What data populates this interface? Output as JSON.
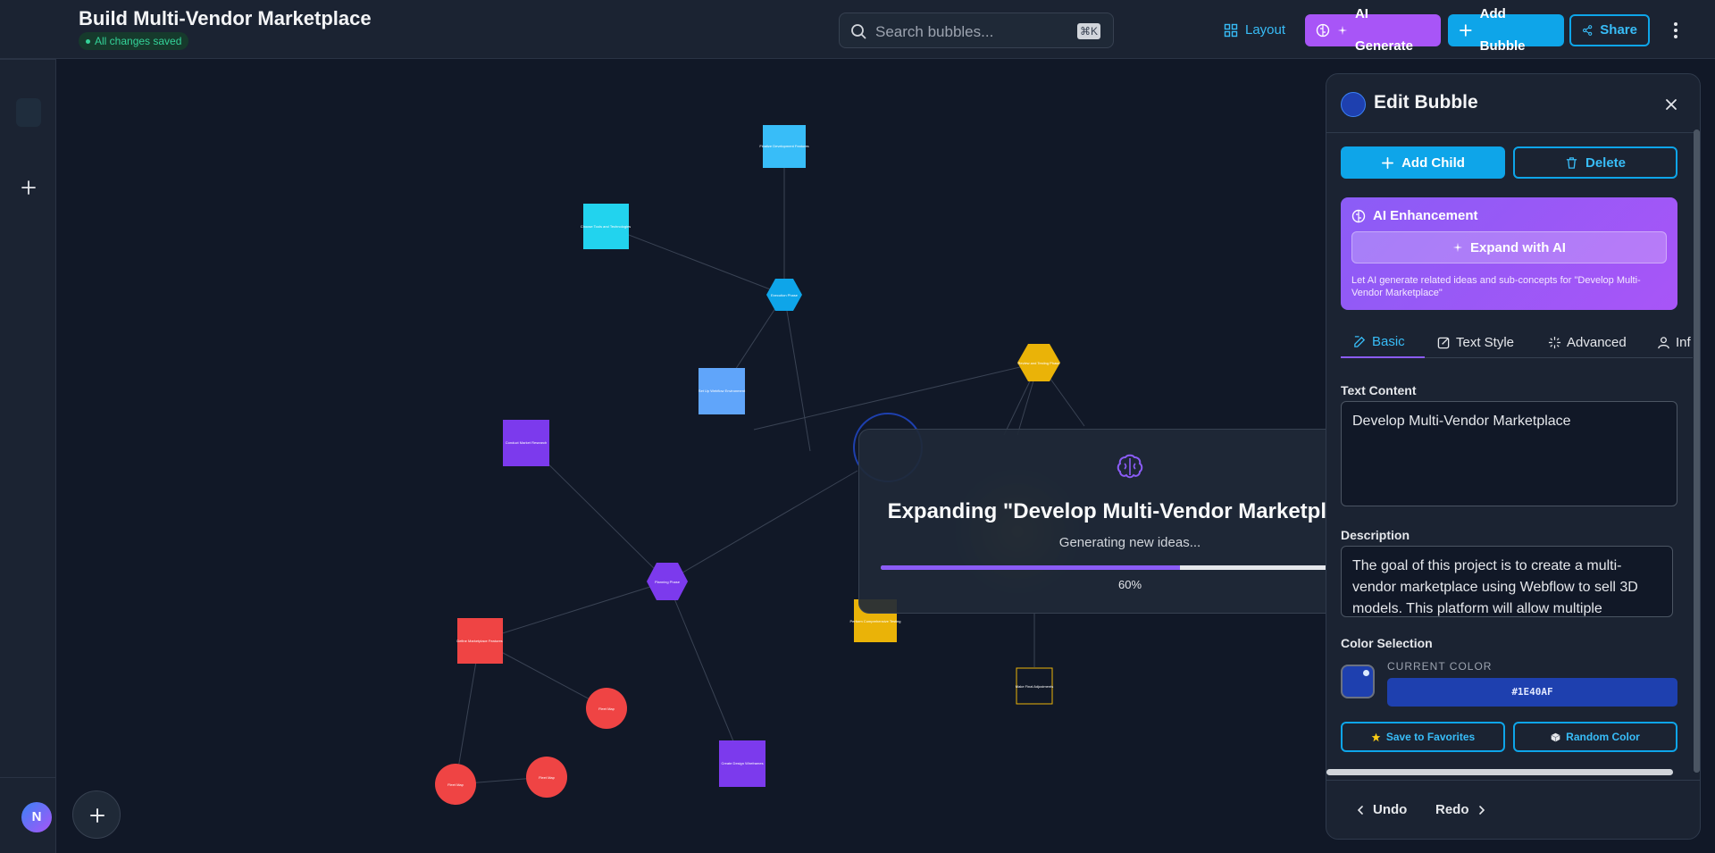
{
  "header": {
    "title": "Build Multi-Vendor Marketplace",
    "saved_status": "All changes saved",
    "search_placeholder": "Search bubbles...",
    "search_shortcut": "⌘K",
    "layout_label": "Layout",
    "ai_generate_label": "AI Generate",
    "add_bubble_label": "Add Bubble",
    "share_label": "Share"
  },
  "sidebar": {
    "avatar_initial": "N"
  },
  "canvas": {
    "nodes": [
      {
        "label": "Finalize Development Features",
        "shape": "square",
        "color": "#38bdf8"
      },
      {
        "label": "Choose Tools and Technologies",
        "shape": "square",
        "color": "#22d3ee"
      },
      {
        "label": "Execution Phase",
        "shape": "hexagon",
        "color": "#0ea5e9"
      },
      {
        "label": "Set Up Webflow Environment",
        "shape": "square",
        "color": "#60a5fa"
      },
      {
        "label": "Conduct Market Research",
        "shape": "square",
        "color": "#7c3aed"
      },
      {
        "label": "Review and Testing Phase",
        "shape": "hexagon",
        "color": "#eab308"
      },
      {
        "label": "Planning Phase",
        "shape": "hexagon",
        "color": "#7c3aed"
      },
      {
        "label": "Define Marketplace Features",
        "shape": "square",
        "color": "#ef4444"
      },
      {
        "label": "Create Design Wireframes",
        "shape": "square",
        "color": "#7c3aed"
      },
      {
        "label": "Perform Comprehensive Testing",
        "shape": "square",
        "color": "#eab308"
      },
      {
        "label": "Make Final Adjustments",
        "shape": "outline-square",
        "color": "#eab308"
      },
      {
        "label": "Fleet Map",
        "shape": "circle",
        "color": "#ef4444"
      },
      {
        "label": "Fleet Map",
        "shape": "circle",
        "color": "#ef4444"
      },
      {
        "label": "Fleet Map",
        "shape": "circle",
        "color": "#ef4444"
      }
    ]
  },
  "modal": {
    "title": "Expanding \"Develop Multi-Vendor Marketplace\"",
    "subtitle": "Generating new ideas...",
    "progress": 0.6,
    "progress_text": "60%"
  },
  "panel": {
    "title": "Edit Bubble",
    "add_child_label": "Add Child",
    "delete_label": "Delete",
    "ai_title": "AI Enhancement",
    "expand_label": "Expand with AI",
    "ai_description": "Let AI generate related ideas and sub-concepts for \"Develop Multi-Vendor Marketplace\"",
    "tabs": [
      {
        "label": "Basic",
        "active": true
      },
      {
        "label": "Text Style",
        "active": false
      },
      {
        "label": "Advanced",
        "active": false
      },
      {
        "label": "Inf",
        "active": false
      }
    ],
    "text_content_label": "Text Content",
    "text_content_value": "Develop Multi-Vendor Marketplace",
    "description_label": "Description",
    "description_value": "The goal of this project is to create a multi-vendor marketplace using Webflow to sell 3D models. This platform will allow multiple",
    "color_selection_label": "Color Selection",
    "current_color_label": "CURRENT COLOR",
    "current_color_value": "#1E40AF",
    "save_favorites_label": "Save to Favorites",
    "random_color_label": "Random Color",
    "undo_label": "Undo",
    "redo_label": "Redo"
  },
  "colors": {
    "accent": "#0ea5e9",
    "ai": "#a855f7",
    "selected_bubble": "#1E40AF",
    "saved": "#34d399"
  }
}
